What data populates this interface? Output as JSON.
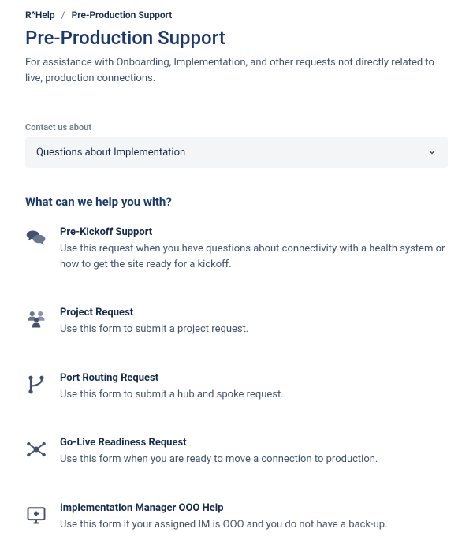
{
  "breadcrumb": {
    "root": "R^Help",
    "current": "Pre-Production Support"
  },
  "page": {
    "title": "Pre-Production Support",
    "description": "For assistance with Onboarding, Implementation, and other requests not directly related to live, production connections."
  },
  "contact": {
    "label": "Contact us about",
    "selected": "Questions about Implementation"
  },
  "help": {
    "heading": "What can we help you with?",
    "options": [
      {
        "title": "Pre-Kickoff Support",
        "description": "Use this request when you have questions about connectivity with a health system or how to get the site ready for a kickoff."
      },
      {
        "title": "Project Request",
        "description": "Use this form to submit a project request."
      },
      {
        "title": "Port Routing Request",
        "description": "Use this form to submit a hub and spoke request."
      },
      {
        "title": "Go-Live Readiness Request",
        "description": "Use this form when you are ready to move a connection to production."
      },
      {
        "title": "Implementation Manager OOO Help",
        "description": "Use this form if your assigned IM is OOO and you do not have a back-up."
      }
    ]
  }
}
